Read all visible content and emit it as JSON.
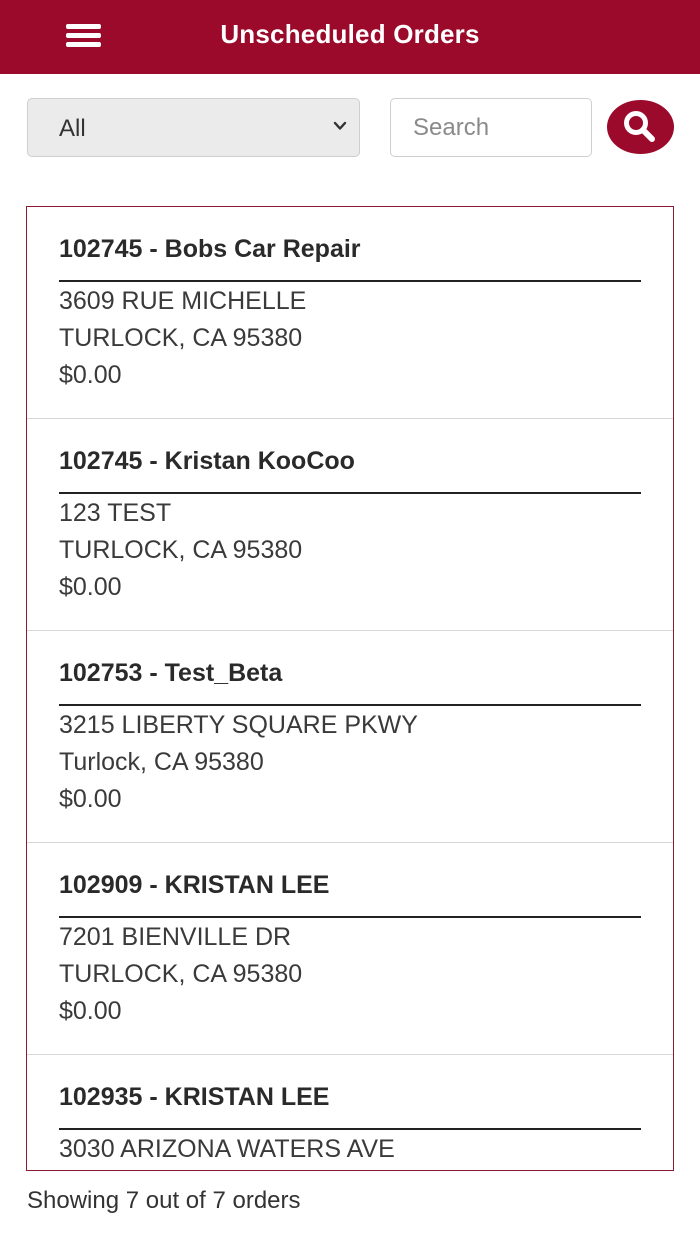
{
  "header": {
    "title": "Unscheduled Orders",
    "menu_icon": "hamburger-menu-icon",
    "color": "#9b0a2b"
  },
  "filter": {
    "selected": "All"
  },
  "search": {
    "placeholder": "Search",
    "value": "",
    "icon": "magnifier-icon"
  },
  "orders": [
    {
      "title": "102745 - Bobs Car Repair",
      "address": "3609 RUE MICHELLE",
      "city": "TURLOCK, CA 95380",
      "amount": "$0.00"
    },
    {
      "title": "102745 - Kristan KooCoo",
      "address": "123 TEST",
      "city": "TURLOCK, CA 95380",
      "amount": "$0.00"
    },
    {
      "title": "102753 - Test_Beta",
      "address": "3215 LIBERTY SQUARE PKWY",
      "city": "Turlock, CA 95380",
      "amount": "$0.00"
    },
    {
      "title": "102909 - KRISTAN LEE",
      "address": "7201 BIENVILLE DR",
      "city": "TURLOCK, CA 95380",
      "amount": "$0.00"
    },
    {
      "title": "102935 - KRISTAN LEE",
      "address": "3030 ARIZONA WATERS AVE",
      "city": "",
      "amount": ""
    }
  ],
  "footer": {
    "count_text": "Showing 7 out of 7 orders"
  }
}
